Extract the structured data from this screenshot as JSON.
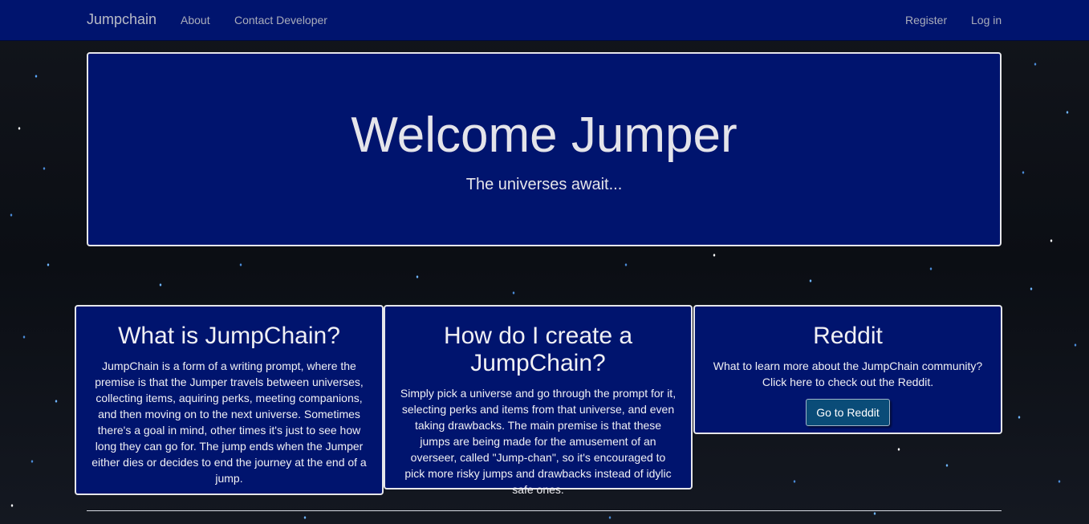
{
  "navbar": {
    "brand": "Jumpchain",
    "links": {
      "about": "About",
      "contact": "Contact Developer",
      "register": "Register",
      "login": "Log in"
    }
  },
  "hero": {
    "title": "Welcome Jumper",
    "subtitle": "The universes await..."
  },
  "cards": [
    {
      "title": "What is JumpChain?",
      "body": "JumpChain is a form of a writing prompt, where the premise is that the Jumper travels between universes, collecting items, aquiring perks, meeting companions, and then moving on to the next universe. Sometimes there's a goal in mind, other times it's just to see how long they can go for. The jump ends when the Jumper either dies or decides to end the journey at the end of a jump."
    },
    {
      "title": "How do I create a JumpChain?",
      "body": "Simply pick a universe and go through the prompt for it, selecting perks and items from that universe, and even taking drawbacks. The main premise is that these jumps are being made for the amusement of an overseer, called \"Jump-chan\", so it's encouraged to pick more risky jumps and drawbacks instead of idylic safe ones."
    },
    {
      "title": "Reddit",
      "body": "What to learn more about the JumpChain community? Click here to check out the Reddit.",
      "button": "Go to Reddit"
    }
  ],
  "colors": {
    "navbar_bg": "#00146e",
    "panel_bg": "#00146e",
    "panel_border": "#e6e6ea",
    "button_bg": "#0a4c78"
  }
}
